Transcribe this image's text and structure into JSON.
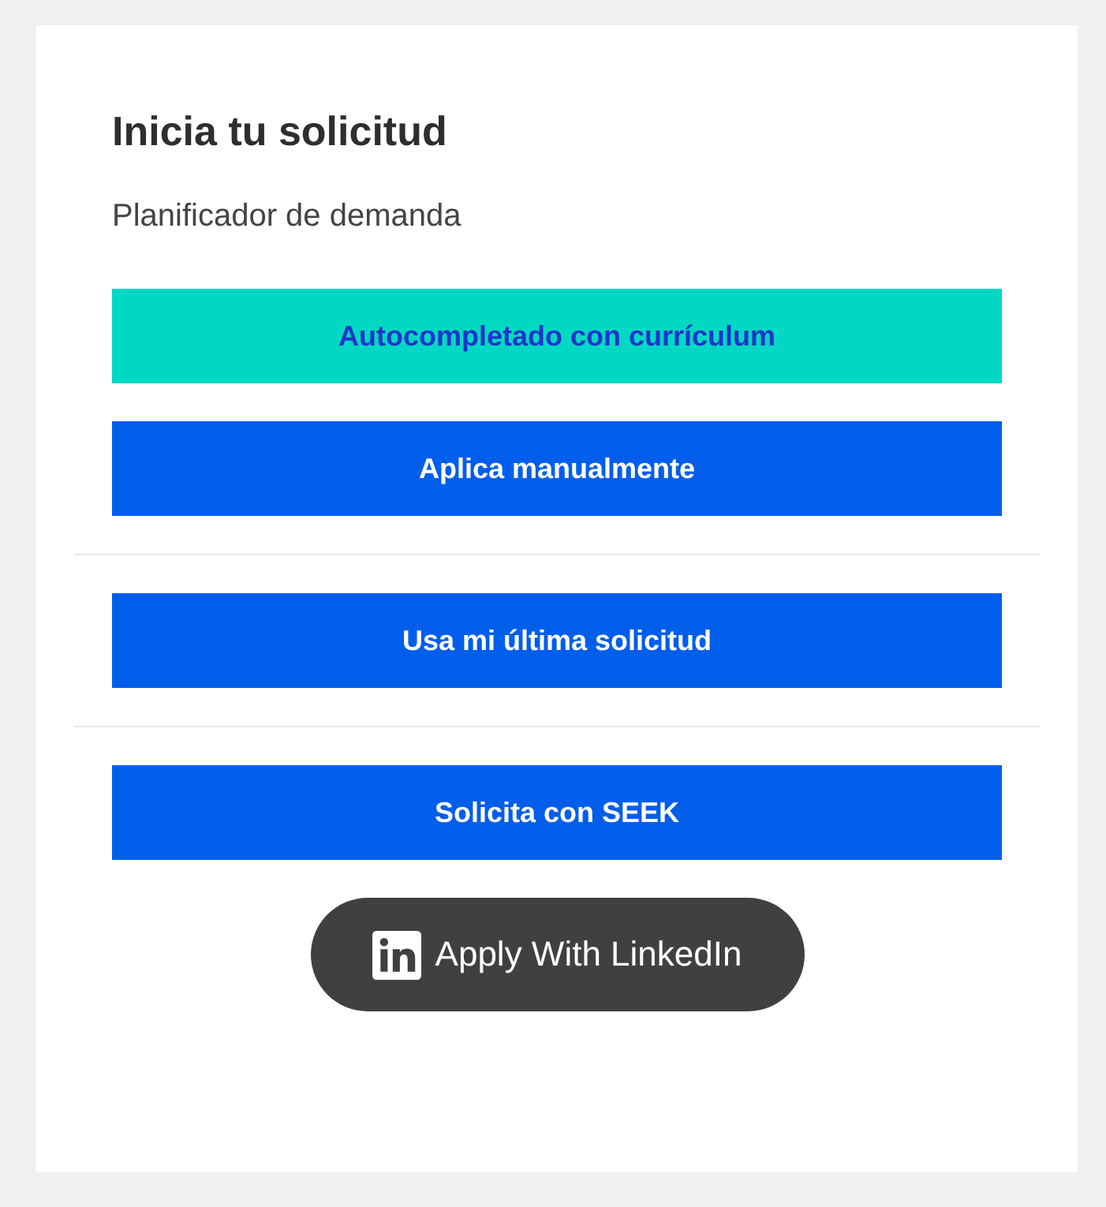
{
  "title": "Inicia tu solicitud",
  "subtitle": "Planificador de demanda",
  "sections": [
    {
      "buttons": [
        {
          "label": "Autocompletado con currículum",
          "kind": "accent"
        },
        {
          "label": "Aplica manualmente",
          "kind": "primary"
        }
      ]
    },
    {
      "buttons": [
        {
          "label": "Usa mi última solicitud",
          "kind": "primary"
        }
      ]
    },
    {
      "buttons": [
        {
          "label": "Solicita con SEEK",
          "kind": "primary"
        },
        {
          "label": "Apply With LinkedIn",
          "kind": "linkedin"
        }
      ]
    }
  ]
}
